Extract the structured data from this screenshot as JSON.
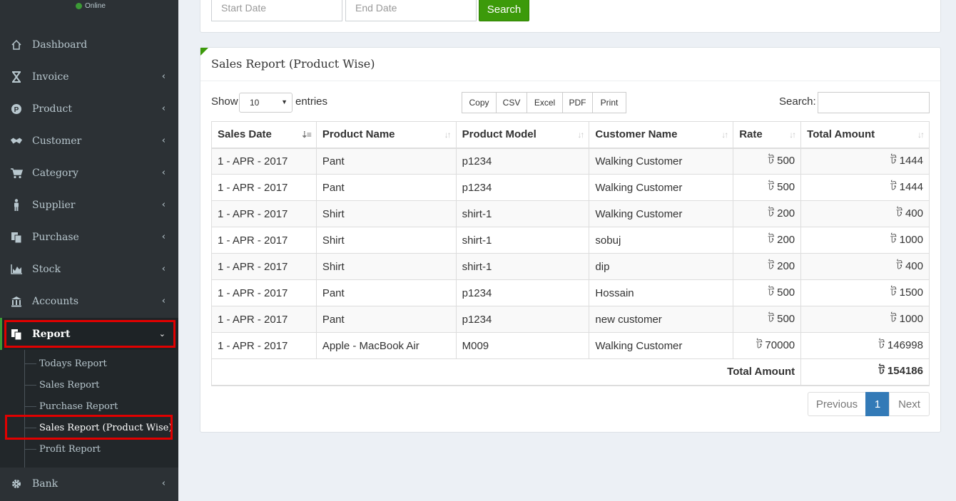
{
  "sidebar": {
    "status": "Online",
    "items": [
      {
        "label": "Dashboard",
        "icon": "home-icon"
      },
      {
        "label": "Invoice",
        "icon": "hourglass-icon"
      },
      {
        "label": "Product",
        "icon": "product-p-icon"
      },
      {
        "label": "Customer",
        "icon": "handshake-icon"
      },
      {
        "label": "Category",
        "icon": "cart-icon"
      },
      {
        "label": "Supplier",
        "icon": "person-icon"
      },
      {
        "label": "Purchase",
        "icon": "copy-icon"
      },
      {
        "label": "Stock",
        "icon": "area-chart-icon"
      },
      {
        "label": "Accounts",
        "icon": "bank-icon"
      },
      {
        "label": "Report",
        "icon": "copy-icon"
      },
      {
        "label": "Bank",
        "icon": "gear-icon"
      }
    ],
    "report_sub": [
      "Todays Report",
      "Sales Report",
      "Purchase Report",
      "Sales Report (Product Wise)",
      "Profit Report"
    ]
  },
  "filter": {
    "start_placeholder": "Start Date",
    "end_placeholder": "End Date",
    "search_button": "Search"
  },
  "report": {
    "title": "Sales Report (Product Wise)",
    "show_label": "Show",
    "entries_value": "10",
    "entries_label": "entries",
    "export_buttons": [
      "Copy",
      "CSV",
      "Excel",
      "PDF",
      "Print"
    ],
    "search_label": "Search:",
    "columns": [
      "Sales Date",
      "Product Name",
      "Product Model",
      "Customer Name",
      "Rate",
      "Total Amount"
    ],
    "rows": [
      [
        "1 - APR - 2017",
        "Pant",
        "p1234",
        "Walking Customer",
        "ট 500",
        "ট 1444"
      ],
      [
        "1 - APR - 2017",
        "Pant",
        "p1234",
        "Walking Customer",
        "ট 500",
        "ট 1444"
      ],
      [
        "1 - APR - 2017",
        "Shirt",
        "shirt-1",
        "Walking Customer",
        "ট 200",
        "ট 400"
      ],
      [
        "1 - APR - 2017",
        "Shirt",
        "shirt-1",
        "sobuj",
        "ট 200",
        "ট 1000"
      ],
      [
        "1 - APR - 2017",
        "Shirt",
        "shirt-1",
        "dip",
        "ট 200",
        "ট 400"
      ],
      [
        "1 - APR - 2017",
        "Pant",
        "p1234",
        "Hossain",
        "ট 500",
        "ট 1500"
      ],
      [
        "1 - APR - 2017",
        "Pant",
        "p1234",
        "new customer",
        "ট 500",
        "ট 1000"
      ],
      [
        "1 - APR - 2017",
        "Apple - MacBook Air",
        "M009",
        "Walking Customer",
        "ট 70000",
        "ট 146998"
      ]
    ],
    "total_label": "Total Amount",
    "total_value": "ট 154186",
    "pagination": {
      "previous": "Previous",
      "current": "1",
      "next": "Next"
    }
  },
  "colors": {
    "sidebar_bg": "#2c3135",
    "accent_green": "#3c9a0a",
    "highlight_red": "#e10000",
    "page_active": "#337ab7"
  }
}
